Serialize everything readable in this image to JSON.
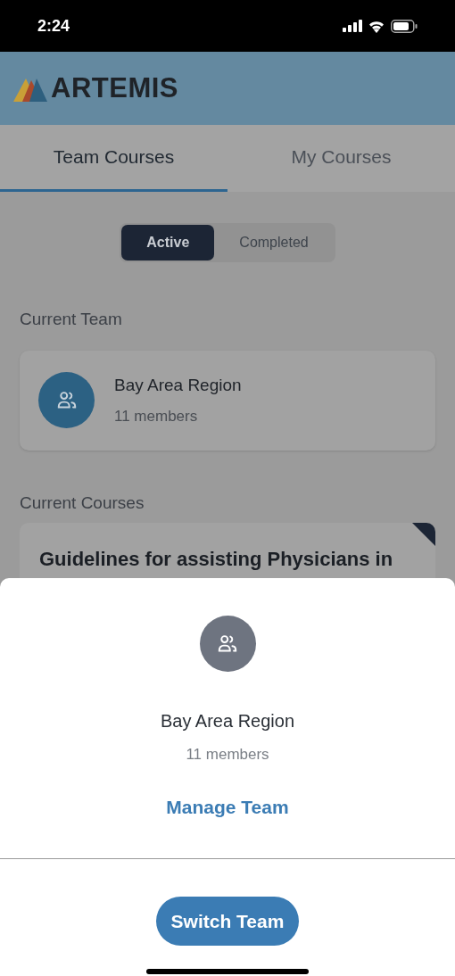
{
  "status_bar": {
    "time": "2:24"
  },
  "header": {
    "logo_text": "ARTEMIS"
  },
  "tabs": [
    {
      "label": "Team Courses",
      "selected": true
    },
    {
      "label": "My Courses",
      "selected": false
    }
  ],
  "filter": [
    {
      "label": "Active",
      "selected": true
    },
    {
      "label": "Completed",
      "selected": false
    }
  ],
  "current_team": {
    "heading": "Current Team",
    "name": "Bay Area Region",
    "members": "11 members"
  },
  "current_courses": {
    "heading": "Current Courses",
    "courses": [
      {
        "title": "Guidelines for assisting Physicians in"
      }
    ]
  },
  "team_sheet": {
    "name": "Bay Area Region",
    "members": "11 members",
    "link": "Manage Team"
  },
  "switch_button": "Switch Team"
}
